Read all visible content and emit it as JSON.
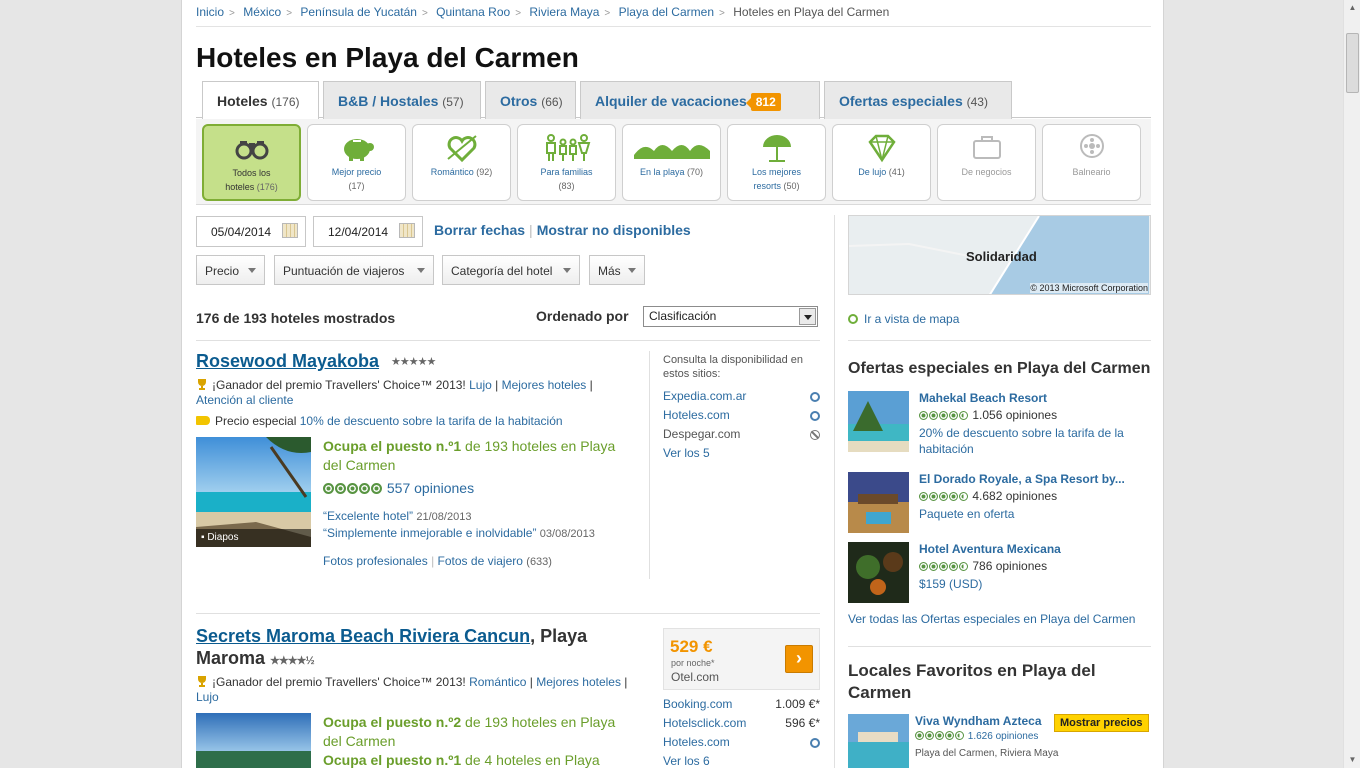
{
  "breadcrumb": [
    "Inicio",
    "México",
    "Península de Yucatán",
    "Quintana Roo",
    "Riviera Maya",
    "Playa del Carmen",
    "Hoteles en Playa del Carmen"
  ],
  "page_title": "Hoteles en Playa del Carmen",
  "tabs": [
    {
      "label": "Hoteles",
      "count": "(176)"
    },
    {
      "label": "B&B / Hostales",
      "count": "(57)"
    },
    {
      "label": "Otros",
      "count": "(66)"
    },
    {
      "label": "Alquiler de vacaciones",
      "badge": "812"
    },
    {
      "label": "Ofertas especiales",
      "count": "(43)"
    }
  ],
  "categories": [
    {
      "label1": "Todos los",
      "label2": "hoteles",
      "count": "(176)",
      "icon": "binoculars-icon"
    },
    {
      "label1": "Mejor precio",
      "count": "(17)",
      "icon": "piggy-bank-icon"
    },
    {
      "label1": "Romántico",
      "count": "(92)",
      "icon": "heart-arrow-icon"
    },
    {
      "label1": "Para familias",
      "count": "(83)",
      "icon": "family-icon"
    },
    {
      "label1": "En la playa",
      "count": "(70)",
      "icon": "waves-icon"
    },
    {
      "label1": "Los mejores",
      "label2": "resorts",
      "count": "(50)",
      "icon": "umbrella-icon"
    },
    {
      "label1": "De lujo",
      "count": "(41)",
      "icon": "diamond-icon"
    },
    {
      "label1": "De negocios",
      "icon": "briefcase-icon"
    },
    {
      "label1": "Balneario",
      "icon": "spa-icon"
    }
  ],
  "dates": {
    "checkin": "05/04/2014",
    "checkout": "12/04/2014",
    "clear": "Borrar fechas",
    "show_unavailable": "Mostrar no disponibles"
  },
  "filters": [
    "Precio",
    "Puntuación de viajeros",
    "Categoría del hotel",
    "Más"
  ],
  "results": {
    "count_text": "176 de 193 hoteles mostrados",
    "sort_label": "Ordenado por",
    "sort_value": "Clasificación"
  },
  "hotel1": {
    "name": "Rosewood Mayakoba",
    "stars": "★★★★★",
    "award_text": "¡Ganador del premio Travellers' Choice™ 2013!",
    "award_links": [
      "Lujo",
      "Mejores hoteles",
      "Atención al cliente"
    ],
    "special_label": "Precio especial",
    "special_link": "10% de descuento sobre la tarifa de la habitación",
    "rank_bold": "Ocupa el puesto n.º1",
    "rank_rest": "de 193 hoteles en Playa del Carmen",
    "reviews": "557 opiniones",
    "quote1": "“Excelente hotel”",
    "quote1_date": "21/08/2013",
    "quote2": "“Simplemente inmejorable e inolvidable”",
    "quote2_date": "03/08/2013",
    "photos_pro": "Fotos profesionales",
    "photos_traveler": "Fotos de viajero",
    "photos_count": "(633)",
    "slideshow": "Diapos",
    "side_title": "Consulta la disponibilidad en estos sitios:",
    "sites": [
      "Expedia.com.ar",
      "Hoteles.com",
      "Despegar.com"
    ],
    "more": "Ver los 5"
  },
  "hotel2": {
    "name": "Secrets Maroma Beach Riviera Cancun",
    "name_suffix": ", Playa",
    "name_line2": "Maroma",
    "stars": "★★★★½",
    "award_text": "¡Ganador del premio Travellers' Choice™ 2013!",
    "award_links": [
      "Romántico",
      "Mejores hoteles",
      "Lujo"
    ],
    "rank_bold": "Ocupa el puesto n.º2",
    "rank_rest": "de 193 hoteles en Playa del Carmen",
    "rank2_bold": "Ocupa el puesto n.º1",
    "rank2_rest": "de 4 hoteles en Playa",
    "price": "529 €",
    "per_night": "por noche*",
    "provider": "Otel.com",
    "sites": [
      {
        "name": "Booking.com",
        "price": "1.009 €*"
      },
      {
        "name": "Hotelsclick.com",
        "price": "596 €*"
      },
      {
        "name": "Hoteles.com",
        "price": ""
      }
    ],
    "more": "Ver los 6"
  },
  "map": {
    "label": "Solidaridad",
    "copyright": "© 2013 Microsoft Corporation",
    "link": "Ir a vista de mapa"
  },
  "deals": {
    "title": "Ofertas especiales en Playa del Carmen",
    "items": [
      {
        "name": "Mahekal Beach Resort",
        "reviews": "1.056 opiniones",
        "info": "20% de descuento sobre la tarifa de la habitación"
      },
      {
        "name": "El Dorado Royale, a Spa Resort by...",
        "reviews": "4.682 opiniones",
        "info": "Paquete en oferta"
      },
      {
        "name": "Hotel Aventura Mexicana",
        "reviews": "786 opiniones",
        "info": "$159 (USD)"
      }
    ],
    "see_all": "Ver todas las Ofertas especiales en Playa del Carmen"
  },
  "locals": {
    "title": "Locales Favoritos en Playa del Carmen",
    "item": {
      "name": "Viva Wyndham Azteca",
      "reviews": "1.626 opiniones",
      "location": "Playa del Carmen, Riviera Maya",
      "button": "Mostrar precios"
    }
  }
}
